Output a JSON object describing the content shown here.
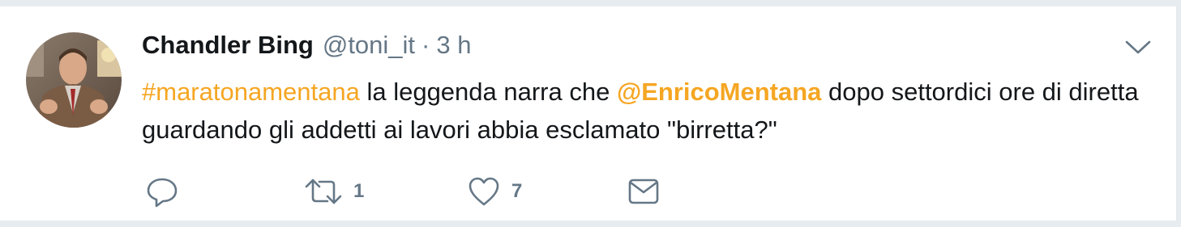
{
  "tweet": {
    "author_name": "Chandler Bing",
    "handle": "@toni_it",
    "separator": "·",
    "time": "3 h",
    "text": {
      "hashtag": "#maratonamentana",
      "part1": " la leggenda narra che ",
      "mention": "@EnricoMentana",
      "part2": " dopo settordici ore di diretta guardando gli addetti ai lavori abbia esclamato \"birretta?\""
    },
    "actions": {
      "reply_icon": "reply-icon",
      "retweet_icon": "retweet-icon",
      "retweet_count": "1",
      "like_icon": "heart-icon",
      "like_count": "7",
      "dm_icon": "envelope-icon"
    },
    "menu_icon": "chevron-down-icon"
  },
  "colors": {
    "link": "#f5a623",
    "text": "#14171a",
    "secondary": "#657786",
    "background": "#e6ecf0"
  }
}
